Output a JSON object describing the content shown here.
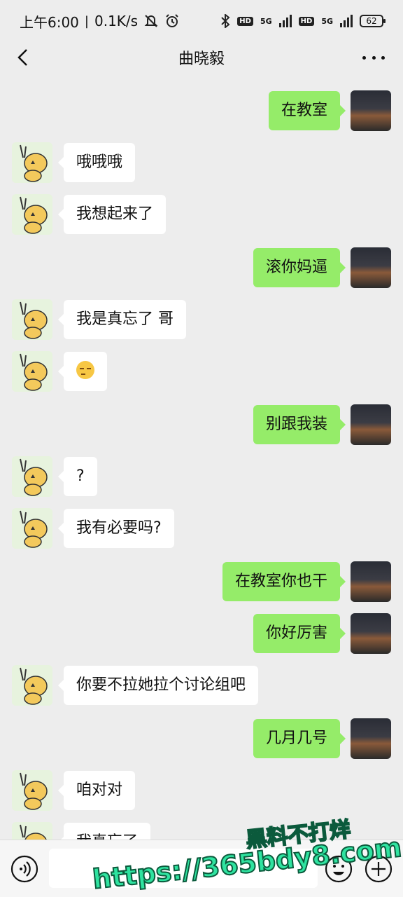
{
  "status_bar": {
    "time": "上午6:00",
    "net_speed": "0.1K/s",
    "battery": "62",
    "sim1": "5G",
    "sim2": "5G",
    "hd1": "HD",
    "hd2": "HD",
    "icons": [
      "mute-icon",
      "alarm-icon",
      "bluetooth-icon",
      "signal-icon",
      "battery-icon"
    ]
  },
  "header": {
    "title": "曲晓毅",
    "back_icon": "back-arrow-icon",
    "more_icon": "more-icon"
  },
  "messages": [
    {
      "side": "right",
      "text": "在教室"
    },
    {
      "side": "left",
      "text": "哦哦哦"
    },
    {
      "side": "left",
      "text": "我想起来了"
    },
    {
      "side": "right",
      "text": "滚你妈逼"
    },
    {
      "side": "left",
      "text": "我是真忘了 哥"
    },
    {
      "side": "left",
      "emoji": "smirk-emoji"
    },
    {
      "side": "right",
      "text": "别跟我装"
    },
    {
      "side": "left",
      "text": "?"
    },
    {
      "side": "left",
      "text": "我有必要吗?"
    },
    {
      "side": "right",
      "text": "在教室你也干"
    },
    {
      "side": "right",
      "text": "你好厉害"
    },
    {
      "side": "left",
      "text": "你要不拉她拉个讨论组吧"
    },
    {
      "side": "right",
      "text": "几月几号"
    },
    {
      "side": "left",
      "text": "咱对对"
    },
    {
      "side": "left",
      "text": "我真忘了"
    }
  ],
  "input_bar": {
    "voice_icon": "voice-icon",
    "emoji_icon": "emoji-icon",
    "plus_icon": "plus-icon",
    "value": ""
  },
  "watermark": {
    "line1": "黑料不打烊",
    "line2": "https://365bdy8.com"
  },
  "colors": {
    "background": "#ededed",
    "bubble_self": "#95ec69",
    "bubble_other": "#ffffff",
    "watermark": "#2fe3a0"
  }
}
